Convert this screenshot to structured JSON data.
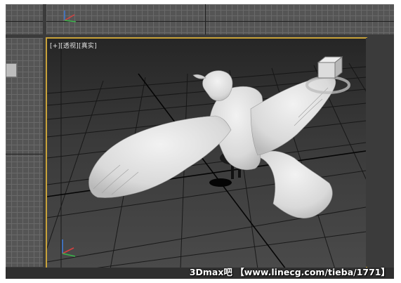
{
  "viewport": {
    "main_label": {
      "plus": "[+]",
      "view": "[透视]",
      "shading": "[真实]"
    },
    "active_border_color": "#c8a23a"
  },
  "watermark": {
    "text": "3Dmax吧 【www.linecg.com/tieba/1771】"
  },
  "icons": {
    "axis_gizmo": "axis-gizmo-icon",
    "viewcube": "viewcube-icon"
  }
}
